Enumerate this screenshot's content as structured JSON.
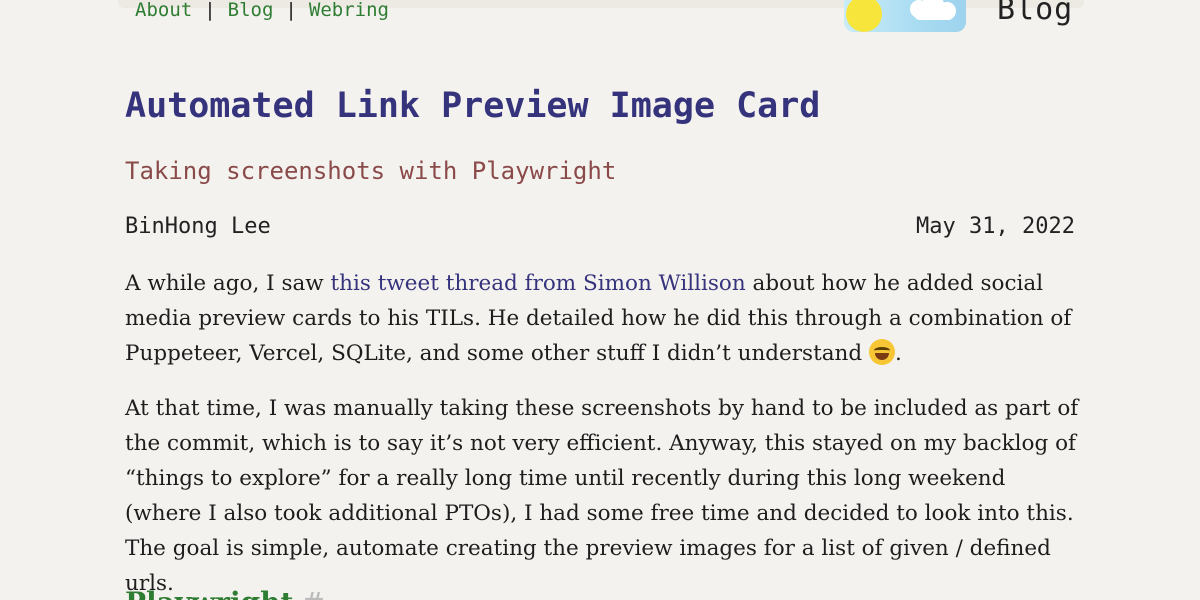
{
  "nav": {
    "items": [
      {
        "label": "About"
      },
      {
        "label": "Blog"
      },
      {
        "label": "Webring"
      }
    ],
    "separator": "|"
  },
  "site": {
    "brand": "Blog"
  },
  "post": {
    "title": "Automated Link Preview Image Card",
    "subtitle": "Taking screenshots with Playwright",
    "author": "BinHong Lee",
    "date": "May 31, 2022",
    "paragraph1": {
      "before": "A while ago, I saw ",
      "link": "this tweet thread from Simon Willison",
      "after": " about how he added social media preview cards to his TILs. He detailed how he did this through a combination of Puppeteer, Vercel, SQLite, and some other stuff I didn’t understand ",
      "end": "."
    },
    "paragraph2": "At that time, I was manually taking these screenshots by hand to be included as part of the commit, which is to say it’s not very efficient. Anyway, this stayed on my backlog of “things to explore” for a really long time until recently during this long weekend (where I also took additional PTOs), I had some free time and decided to look into this. The goal is simple, automate creating the preview images for a list of given / defined urls.",
    "section_heading": "Playwright",
    "section_anchor": "#"
  },
  "icons": {
    "emoji": "sweat-smile-emoji-icon",
    "logo": "sun-cloud-logo-icon"
  },
  "colors": {
    "background": "#f4f2ee",
    "title": "#35337c",
    "subtitle": "#8a4a4a",
    "nav": "#2e7d32",
    "link": "#35337c"
  }
}
